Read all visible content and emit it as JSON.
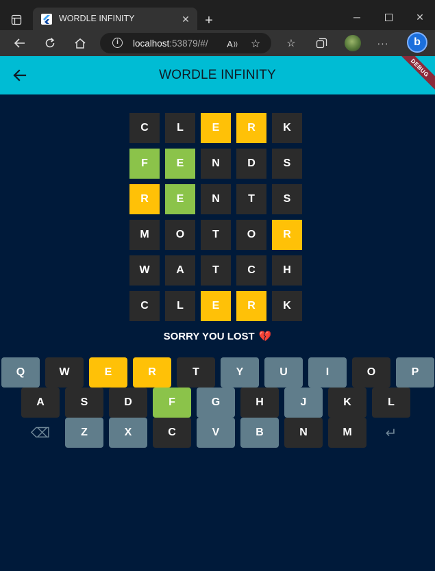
{
  "browser": {
    "tab_title": "WORDLE INFINITY",
    "url_host": "localhost",
    "url_rest": ":53879/#/"
  },
  "app": {
    "title": "WORDLE INFINITY",
    "debug_banner": "DEBUG",
    "result_message": "SORRY YOU LOST",
    "result_emoji": "💔"
  },
  "colors": {
    "appbar": "#00bcd4",
    "background": "#001a3a",
    "correct": "#8bc34a",
    "present": "#ffc107",
    "absent": "#2b2b2b",
    "unused": "#607d8b",
    "debug": "#8b2a3a"
  },
  "board": [
    [
      {
        "l": "C",
        "s": "absent"
      },
      {
        "l": "L",
        "s": "absent"
      },
      {
        "l": "E",
        "s": "present"
      },
      {
        "l": "R",
        "s": "present"
      },
      {
        "l": "K",
        "s": "absent"
      }
    ],
    [
      {
        "l": "F",
        "s": "correct"
      },
      {
        "l": "E",
        "s": "correct"
      },
      {
        "l": "N",
        "s": "absent"
      },
      {
        "l": "D",
        "s": "absent"
      },
      {
        "l": "S",
        "s": "absent"
      }
    ],
    [
      {
        "l": "R",
        "s": "present"
      },
      {
        "l": "E",
        "s": "correct"
      },
      {
        "l": "N",
        "s": "absent"
      },
      {
        "l": "T",
        "s": "absent"
      },
      {
        "l": "S",
        "s": "absent"
      }
    ],
    [
      {
        "l": "M",
        "s": "absent"
      },
      {
        "l": "O",
        "s": "absent"
      },
      {
        "l": "T",
        "s": "absent"
      },
      {
        "l": "O",
        "s": "absent"
      },
      {
        "l": "R",
        "s": "present"
      }
    ],
    [
      {
        "l": "W",
        "s": "absent"
      },
      {
        "l": "A",
        "s": "absent"
      },
      {
        "l": "T",
        "s": "absent"
      },
      {
        "l": "C",
        "s": "absent"
      },
      {
        "l": "H",
        "s": "absent"
      }
    ],
    [
      {
        "l": "C",
        "s": "absent"
      },
      {
        "l": "L",
        "s": "absent"
      },
      {
        "l": "E",
        "s": "present"
      },
      {
        "l": "R",
        "s": "present"
      },
      {
        "l": "K",
        "s": "absent"
      }
    ]
  ],
  "keyboard": [
    [
      {
        "k": "Q",
        "s": "unused"
      },
      {
        "k": "W",
        "s": "absent"
      },
      {
        "k": "E",
        "s": "present"
      },
      {
        "k": "R",
        "s": "present"
      },
      {
        "k": "T",
        "s": "absent"
      },
      {
        "k": "Y",
        "s": "unused"
      },
      {
        "k": "U",
        "s": "unused"
      },
      {
        "k": "I",
        "s": "unused"
      },
      {
        "k": "O",
        "s": "absent"
      },
      {
        "k": "P",
        "s": "unused"
      }
    ],
    [
      {
        "k": "A",
        "s": "absent"
      },
      {
        "k": "S",
        "s": "absent"
      },
      {
        "k": "D",
        "s": "absent"
      },
      {
        "k": "F",
        "s": "correct"
      },
      {
        "k": "G",
        "s": "unused"
      },
      {
        "k": "H",
        "s": "absent"
      },
      {
        "k": "J",
        "s": "unused"
      },
      {
        "k": "K",
        "s": "absent"
      },
      {
        "k": "L",
        "s": "absent"
      }
    ],
    [
      {
        "k": "⌫",
        "s": "action",
        "name": "backspace-key"
      },
      {
        "k": "Z",
        "s": "unused"
      },
      {
        "k": "X",
        "s": "unused"
      },
      {
        "k": "C",
        "s": "absent"
      },
      {
        "k": "V",
        "s": "unused"
      },
      {
        "k": "B",
        "s": "unused"
      },
      {
        "k": "N",
        "s": "absent"
      },
      {
        "k": "M",
        "s": "absent"
      },
      {
        "k": "↵",
        "s": "action",
        "name": "enter-key"
      }
    ]
  ]
}
